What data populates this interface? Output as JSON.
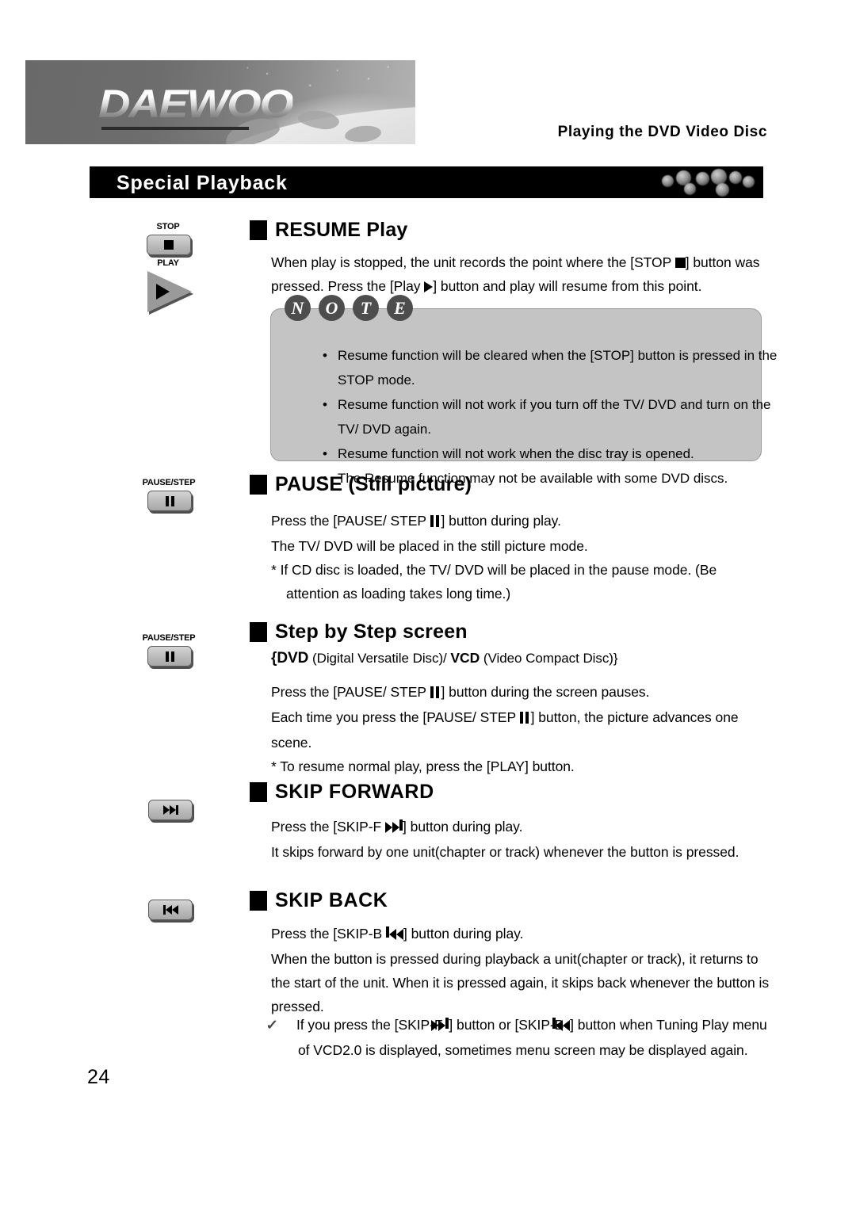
{
  "document": {
    "page_number": "24",
    "running_head": "Playing the DVD Video Disc",
    "brand": "DAEWOO",
    "chapter_title": "Special Playback"
  },
  "gutter_keys": {
    "stop_label": "STOP",
    "play_label": "PLAY",
    "pause_step_label_1": "PAUSE/STEP",
    "pause_step_label_2": "PAUSE/STEP",
    "skip_forward_icon": "skip-forward-icon",
    "skip_back_icon": "skip-back-icon"
  },
  "sections": {
    "resume": {
      "heading": "RESUME Play",
      "body_line_1_a": "When play is stopped, the unit records the point where  the [STOP ",
      "body_line_1_b": "] button was",
      "body_line_2_a": "pressed. Press the [Play ",
      "body_line_2_b": "] button and play will resume from this point."
    },
    "note": {
      "letters": [
        "N",
        "O",
        "T",
        "E"
      ],
      "items": [
        "Resume function will be cleared when the [STOP] button is pressed in the STOP mode.",
        "Resume function will not work if you turn off the TV/ DVD and turn on the TV/ DVD again.",
        "Resume function will not work when the disc tray is opened.",
        "The Resume function may not be available with some DVD discs."
      ]
    },
    "pause": {
      "heading": "PAUSE (Still picture)",
      "line_1_a": "Press the [PAUSE/ STEP ",
      "line_1_b": "] button during play.",
      "line_2": "The TV/ DVD will be placed in the still picture mode.",
      "line_3": "*  If CD disc is loaded, the TV/ DVD will be placed in the pause mode. (Be attention as loading takes long time.)"
    },
    "step_by_step": {
      "heading": "Step by Step screen",
      "formats_a": "{DVD",
      "formats_b": " (Digital Versatile Disc)/ ",
      "formats_c": "VCD",
      "formats_d": " (Video Compact Disc)}",
      "line_1_a": "Press the [PAUSE/ STEP ",
      "line_1_b": "] button during the screen pauses.",
      "line_2_a": "Each time you press the [PAUSE/ STEP ",
      "line_2_b": "] button, the picture advances one scene.",
      "line_3": "*  To resume normal play, press the [PLAY] button."
    },
    "skip_forward": {
      "heading": "SKIP FORWARD",
      "line_1_a": "Press the [SKIP-F ",
      "line_1_b": "] button during play.",
      "line_2": "It skips forward by one unit(chapter or track) whenever the button is pressed."
    },
    "skip_back": {
      "heading": "SKIP BACK",
      "line_1_a": "Press the [SKIP-B ",
      "line_1_b": "] button during play.",
      "line_2": "When the button is pressed during playback a unit(chapter or track), it returns to the start of the unit. When it is pressed again, it skips back whenever the button is pressed.",
      "check_a": "If you press the [SKIP-F ",
      "check_b": "] button or [SKIP-B ",
      "check_c": "] button when Tuning Play menu of VCD2.0 is displayed, sometimes menu screen may be displayed again.",
      "check_glyph": "✓"
    }
  },
  "colors": {
    "title_bar_bg": "#000000",
    "title_bar_text": "#ffffff",
    "note_box_bg": "#c4c4c4",
    "note_circle_bg": "#4d4d4d",
    "key_face": "#bdbdbd",
    "page_bg": "#ffffff"
  }
}
